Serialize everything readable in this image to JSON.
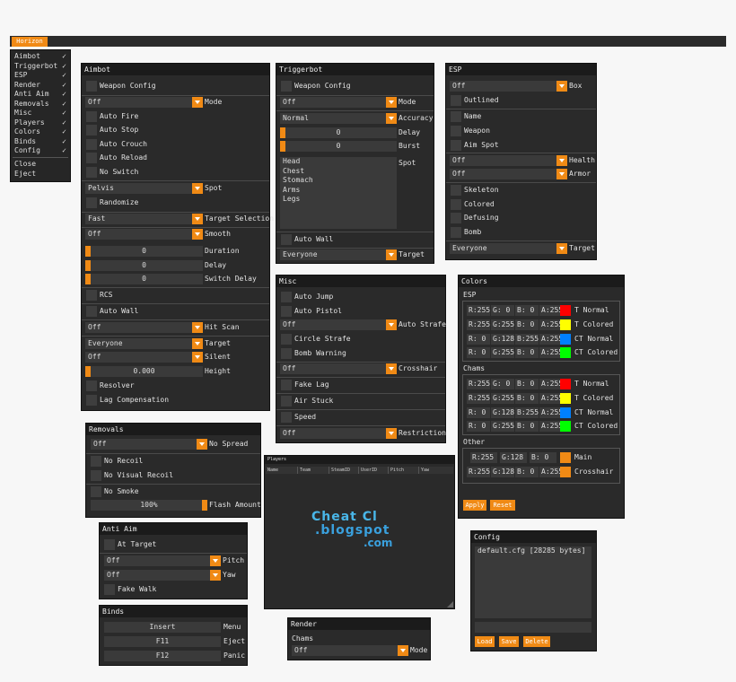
{
  "topbar": {
    "button": "Horizon"
  },
  "menu": {
    "items": [
      {
        "label": "Aimbot",
        "checked": "✓"
      },
      {
        "label": "Triggerbot",
        "checked": "✓"
      },
      {
        "label": "ESP",
        "checked": "✓"
      },
      {
        "label": "Render",
        "checked": "✓"
      },
      {
        "label": "Anti Aim",
        "checked": "✓"
      },
      {
        "label": "Removals",
        "checked": "✓"
      },
      {
        "label": "Misc",
        "checked": "✓"
      },
      {
        "label": "Players",
        "checked": "✓"
      },
      {
        "label": "Colors",
        "checked": "✓"
      },
      {
        "label": "Binds",
        "checked": "✓"
      },
      {
        "label": "Config",
        "checked": "✓"
      }
    ],
    "close": "Close",
    "eject": "Eject"
  },
  "aimbot": {
    "title": "Aimbot",
    "weapon_config": "Weapon Config",
    "mode_value": "Off",
    "mode_label": "Mode",
    "auto_fire": "Auto Fire",
    "auto_stop": "Auto Stop",
    "auto_crouch": "Auto Crouch",
    "auto_reload": "Auto Reload",
    "no_switch": "No Switch",
    "spot_value": "Pelvis",
    "spot_label": "Spot",
    "randomize": "Randomize",
    "target_sel_value": "Fast",
    "target_sel_label": "Target Selection",
    "smooth_value": "Off",
    "smooth_label": "Smooth",
    "duration_value": "0",
    "duration_label": "Duration",
    "delay_value": "0",
    "delay_label": "Delay",
    "switch_delay_value": "0",
    "switch_delay_label": "Switch Delay",
    "rcs": "RCS",
    "auto_wall": "Auto Wall",
    "hitscan_value": "Off",
    "hitscan_label": "Hit Scan",
    "target_value": "Everyone",
    "target_label": "Target",
    "silent_value": "Off",
    "silent_label": "Silent",
    "height_value": "0.000",
    "height_label": "Height",
    "resolver": "Resolver",
    "lag_comp": "Lag Compensation"
  },
  "triggerbot": {
    "title": "Triggerbot",
    "weapon_config": "Weapon Config",
    "mode_value": "Off",
    "mode_label": "Mode",
    "accuracy_value": "Normal",
    "accuracy_label": "Accuracy",
    "delay_value": "0",
    "delay_label": "Delay",
    "burst_value": "0",
    "burst_label": "Burst",
    "spots": [
      "Head",
      "Chest",
      "Stomach",
      "Arms",
      "Legs"
    ],
    "spot_label": "Spot",
    "auto_wall": "Auto Wall",
    "target_value": "Everyone",
    "target_label": "Target"
  },
  "esp": {
    "title": "ESP",
    "box_value": "Off",
    "box_label": "Box",
    "outlined": "Outlined",
    "name": "Name",
    "weapon": "Weapon",
    "aim_spot": "Aim Spot",
    "health_value": "Off",
    "health_label": "Health",
    "armor_value": "Off",
    "armor_label": "Armor",
    "skeleton": "Skeleton",
    "colored": "Colored",
    "defusing": "Defusing",
    "bomb": "Bomb",
    "target_value": "Everyone",
    "target_label": "Target"
  },
  "misc": {
    "title": "Misc",
    "auto_jump": "Auto Jump",
    "auto_pistol": "Auto Pistol",
    "auto_strafe_value": "Off",
    "auto_strafe_label": "Auto Strafe",
    "circle_strafe": "Circle Strafe",
    "bomb_warning": "Bomb Warning",
    "crosshair_value": "Off",
    "crosshair_label": "Crosshair",
    "fake_lag": "Fake Lag",
    "air_stuck": "Air Stuck",
    "speed": "Speed",
    "restriction_value": "Off",
    "restriction_label": "Restriction"
  },
  "colors": {
    "title": "Colors",
    "esp_heading": "ESP",
    "esp_rows": [
      {
        "r": "R:255",
        "g": "G:  0",
        "b": "B:  0",
        "a": "A:255",
        "swatch": "#ff0000",
        "label": "T Normal"
      },
      {
        "r": "R:255",
        "g": "G:255",
        "b": "B:  0",
        "a": "A:255",
        "swatch": "#ffff00",
        "label": "T Colored"
      },
      {
        "r": "R:  0",
        "g": "G:128",
        "b": "B:255",
        "a": "A:255",
        "swatch": "#0080ff",
        "label": "CT Normal"
      },
      {
        "r": "R:  0",
        "g": "G:255",
        "b": "B:  0",
        "a": "A:255",
        "swatch": "#00ff00",
        "label": "CT Colored"
      }
    ],
    "chams_heading": "Chams",
    "chams_rows": [
      {
        "r": "R:255",
        "g": "G:  0",
        "b": "B:  0",
        "a": "A:255",
        "swatch": "#ff0000",
        "label": "T Normal"
      },
      {
        "r": "R:255",
        "g": "G:255",
        "b": "B:  0",
        "a": "A:255",
        "swatch": "#ffff00",
        "label": "T Colored"
      },
      {
        "r": "R:  0",
        "g": "G:128",
        "b": "B:255",
        "a": "A:255",
        "swatch": "#0080ff",
        "label": "CT Normal"
      },
      {
        "r": "R:  0",
        "g": "G:255",
        "b": "B:  0",
        "a": "A:255",
        "swatch": "#00ff00",
        "label": "CT Colored"
      }
    ],
    "other_heading": "Other",
    "main": {
      "r": "R:255",
      "g": "G:128",
      "b": "B:  0",
      "swatch": "#f08a15",
      "label": "Main"
    },
    "crosshair": {
      "r": "R:255",
      "g": "G:128",
      "b": "B:  0",
      "a": "A:255",
      "swatch": "#f08a15",
      "label": "Crosshair"
    },
    "apply": "Apply",
    "reset": "Reset"
  },
  "removals": {
    "title": "Removals",
    "spread_value": "Off",
    "spread_label": "No Spread",
    "no_recoil": "No Recoil",
    "no_visual_recoil": "No Visual Recoil",
    "no_smoke": "No Smoke",
    "flash_value": "100%",
    "flash_label": "Flash Amount"
  },
  "players": {
    "title": "Players",
    "columns": [
      "Name",
      "Team",
      "SteamID",
      "UserID",
      "Pitch",
      "Yaw"
    ],
    "watermark_line1": "Cheat Cl",
    "watermark_line2": ".blogspot",
    "watermark_line3": ".com"
  },
  "antiaim": {
    "title": "Anti Aim",
    "at_target": "At Target",
    "pitch_value": "Off",
    "pitch_label": "Pitch",
    "yaw_value": "Off",
    "yaw_label": "Yaw",
    "fake_walk": "Fake Walk"
  },
  "config": {
    "title": "Config",
    "files": [
      "default.cfg [28285 bytes]"
    ],
    "load": "Load",
    "save": "Save",
    "delete": "Delete"
  },
  "binds": {
    "title": "Binds",
    "rows": [
      {
        "key": "Insert",
        "label": "Menu"
      },
      {
        "key": "F11",
        "label": "Eject"
      },
      {
        "key": "F12",
        "label": "Panic"
      }
    ]
  },
  "render": {
    "title": "Render",
    "chams_label": "Chams",
    "mode_value": "Off",
    "mode_label": "Mode"
  }
}
